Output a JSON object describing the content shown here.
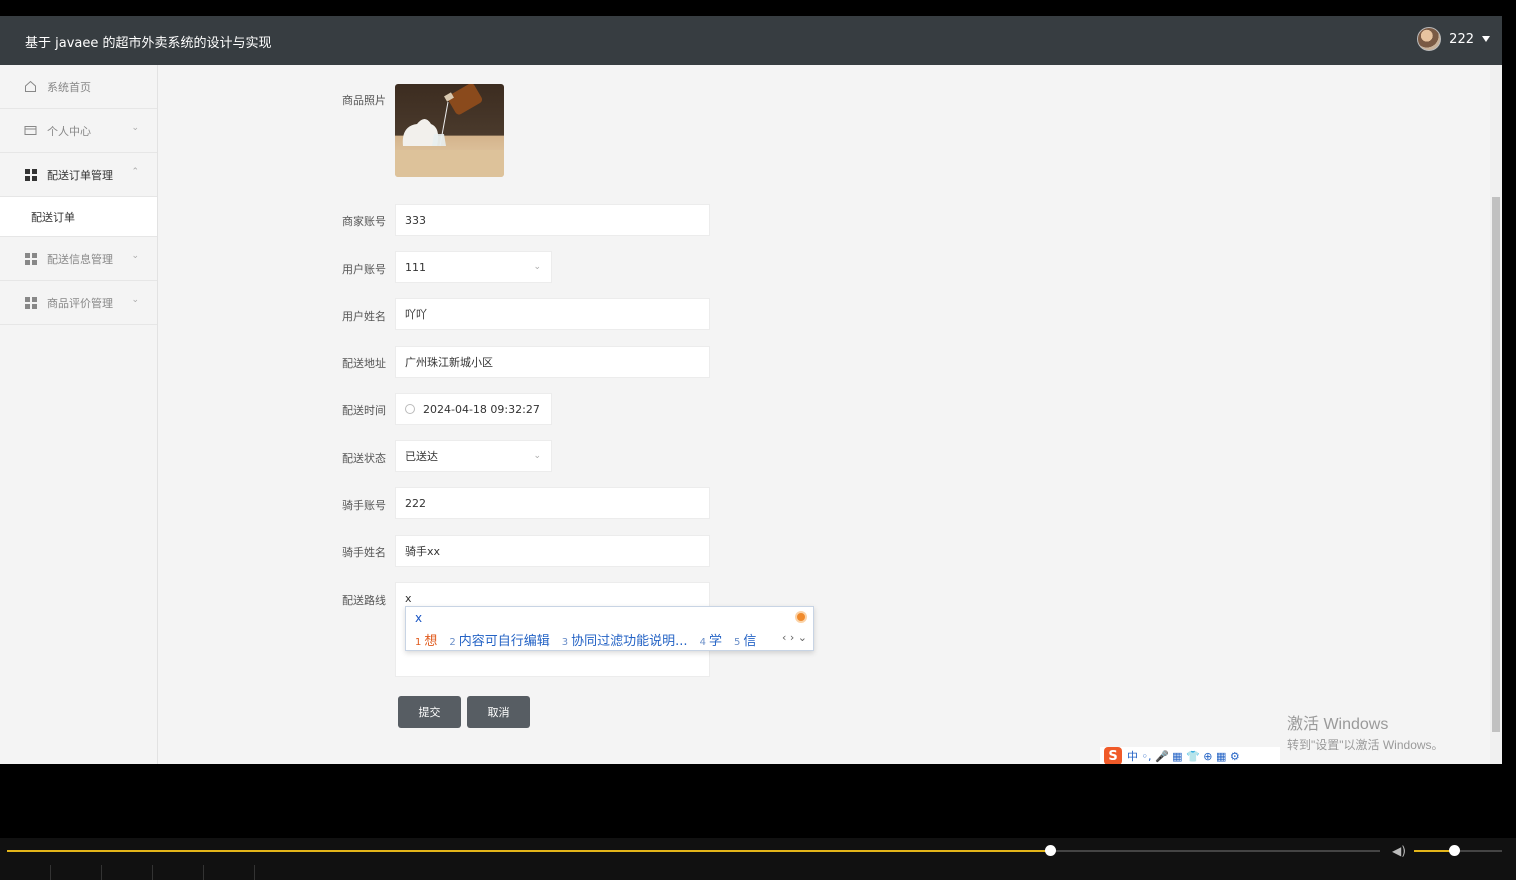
{
  "app": {
    "title": "基于 javaee 的超市外卖系统的设计与实现",
    "username": "222"
  },
  "sidebar": {
    "items": [
      {
        "label": "系统首页",
        "icon": "home-icon"
      },
      {
        "label": "个人中心",
        "icon": "card-icon",
        "chevron": "⌄"
      },
      {
        "label": "配送订单管理",
        "icon": "grid-icon",
        "chevron": "⌃"
      },
      {
        "label": "配送信息管理",
        "icon": "grid-icon",
        "chevron": "⌄"
      },
      {
        "label": "商品评价管理",
        "icon": "grid-icon",
        "chevron": "⌄"
      }
    ],
    "subitem": "配送订单"
  },
  "form": {
    "photo_label": "商品照片",
    "merchant_account_label": "商家账号",
    "merchant_account": "333",
    "user_account_label": "用户账号",
    "user_account": "111",
    "user_name_label": "用户姓名",
    "user_name": "吖吖",
    "address_label": "配送地址",
    "address": "广州珠江新城小区",
    "time_label": "配送时间",
    "time": "2024-04-18 09:32:27",
    "status_label": "配送状态",
    "status": "已送达",
    "rider_account_label": "骑手账号",
    "rider_account": "222",
    "rider_name_label": "骑手姓名",
    "rider_name": "骑手xx",
    "route_label": "配送路线",
    "route": "x",
    "submit": "提交",
    "cancel": "取消"
  },
  "ime": {
    "input": "x",
    "candidates": [
      {
        "n": "1",
        "text": "想"
      },
      {
        "n": "2",
        "text": "内容可自行编辑"
      },
      {
        "n": "3",
        "text": "协同过滤功能说明..."
      },
      {
        "n": "4",
        "text": "学"
      },
      {
        "n": "5",
        "text": "信"
      }
    ],
    "nav": "‹ › ⌄",
    "bar_label": "中 ◦, 🎤 ▦ 👕 ⊕ ▦ ⚙"
  },
  "watermark": {
    "line1": "激活 Windows",
    "line2": "转到\"设置\"以激活 Windows。"
  },
  "player": {
    "progress": 0.76,
    "volume": 0.45
  }
}
